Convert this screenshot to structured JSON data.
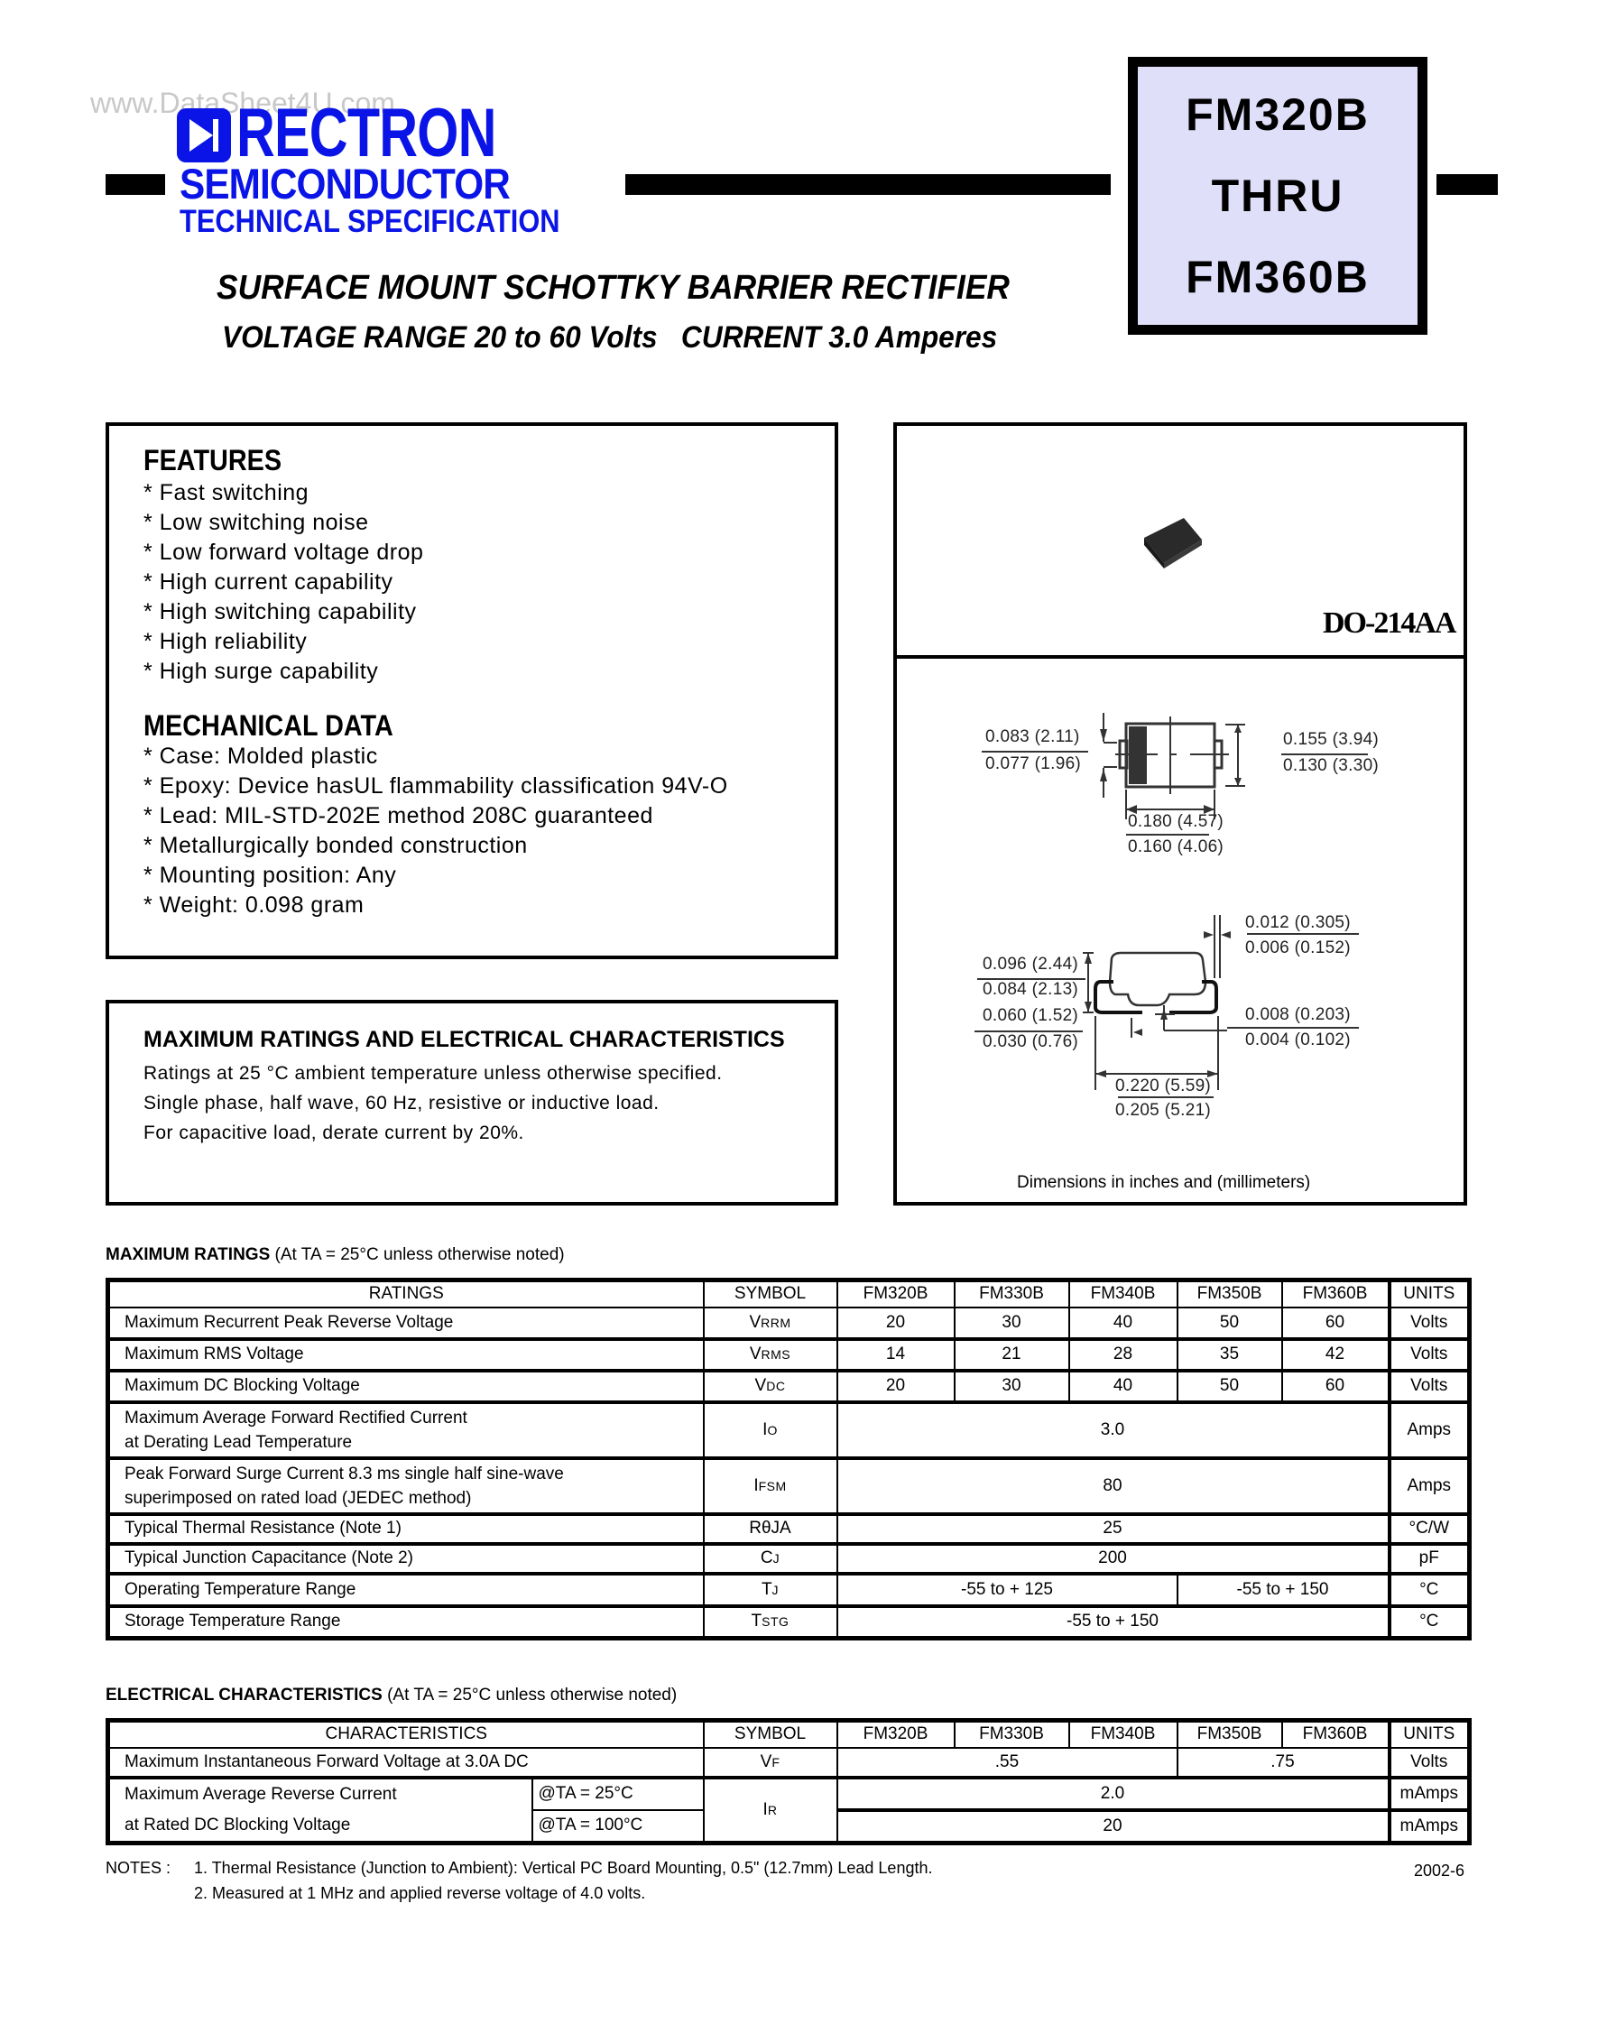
{
  "header": {
    "watermark": "www.DataSheet4U.com",
    "brand": "RECTRON",
    "division": "SEMICONDUCTOR",
    "doc_type": "TECHNICAL SPECIFICATION",
    "brand_color": "#0a14e6",
    "part_range": [
      "FM320B",
      "THRU",
      "FM360B"
    ],
    "part_box_color": "#dfdff9"
  },
  "title": {
    "line1": "SURFACE MOUNT SCHOTTKY BARRIER RECTIFIER",
    "line2": "VOLTAGE RANGE 20 to 60 Volts   CURRENT 3.0 Amperes"
  },
  "features": {
    "heading": "FEATURES",
    "items": [
      "* Fast switching",
      "* Low switching noise",
      "* Low forward voltage drop",
      "* High current capability",
      "* High switching capability",
      "* High reliability",
      "* High surge capability"
    ]
  },
  "mechanical": {
    "heading": "MECHANICAL DATA",
    "items": [
      "* Case: Molded plastic",
      "* Epoxy: Device hasUL flammability classification 94V-O",
      "* Lead: MIL-STD-202E method 208C guaranteed",
      "* Metallurgically bonded construction",
      "* Mounting position: Any",
      "* Weight: 0.098 gram"
    ]
  },
  "ratings_note": {
    "heading": "MAXIMUM RATINGS AND ELECTRICAL CHARACTERISTICS",
    "lines": [
      "Ratings at 25 °C ambient temperature unless otherwise specified.",
      "Single phase, half wave, 60 Hz, resistive or inductive load.",
      "For capacitive load, derate current by 20%."
    ]
  },
  "package": {
    "name": "DO-214AA",
    "top_view": {
      "height_lead": [
        "0.083 (2.11)",
        "0.077 (1.96)"
      ],
      "width_body": [
        "0.155 (3.94)",
        "0.130 (3.30)"
      ],
      "length_body": [
        "0.180 (4.57)",
        "0.160 (4.06)"
      ]
    },
    "side_view": {
      "lead_thickness": [
        "0.012 (0.305)",
        "0.006 (0.152)"
      ],
      "height": [
        "0.096 (2.44)",
        "0.084 (2.13)"
      ],
      "lead_length": [
        "0.060 (1.52)",
        "0.030 (0.76)"
      ],
      "standoff": [
        "0.008 (0.203)",
        "0.004 (0.102)"
      ],
      "overall_length": [
        "0.220 (5.59)",
        "0.205 (5.21)"
      ]
    },
    "caption": "Dimensions in inches and (millimeters)"
  },
  "max_ratings": {
    "heading_bold": "MAXIMUM RATINGS",
    "heading_rest": " (At TA = 25°C unless otherwise noted)",
    "columns": [
      "RATINGS",
      "SYMBOL",
      "FM320B",
      "FM330B",
      "FM340B",
      "FM350B",
      "FM360B",
      "UNITS"
    ],
    "rows": [
      {
        "param": "Maximum Recurrent Peak Reverse Voltage",
        "sym": "V",
        "sub": "RRM",
        "values": [
          "20",
          "30",
          "40",
          "50",
          "60"
        ],
        "unit": "Volts"
      },
      {
        "param": "Maximum RMS Voltage",
        "sym": "V",
        "sub": "RMS",
        "values": [
          "14",
          "21",
          "28",
          "35",
          "42"
        ],
        "unit": "Volts"
      },
      {
        "param": "Maximum DC Blocking Voltage",
        "sym": "V",
        "sub": "DC",
        "values": [
          "20",
          "30",
          "40",
          "50",
          "60"
        ],
        "unit": "Volts"
      },
      {
        "param": "Maximum Average Forward Rectified Current\nat Derating Lead Temperature",
        "sym": "I",
        "sub": "O",
        "value_all": "3.0",
        "unit": "Amps"
      },
      {
        "param": "Peak Forward Surge Current 8.3 ms single half sine-wave\nsuperimposed on rated load (JEDEC method)",
        "sym": "I",
        "sub": "FSM",
        "value_all": "80",
        "unit": "Amps"
      },
      {
        "param": "Typical Thermal Resistance (Note 1)",
        "sym": "RθJA",
        "sub": "",
        "value_all": "25",
        "unit": "°C/W"
      },
      {
        "param": "Typical Junction Capacitance (Note 2)",
        "sym": "C",
        "sub": "J",
        "value_all": "200",
        "unit": "pF"
      },
      {
        "param": "Operating Temperature Range",
        "sym": "T",
        "sub": "J",
        "value_a": "-55 to + 125",
        "value_b": "-55 to + 150",
        "unit": "°C"
      },
      {
        "param": "Storage Temperature Range",
        "sym": "T",
        "sub": "STG",
        "value_all": "-55 to + 150",
        "unit": "°C"
      }
    ]
  },
  "elec_chars": {
    "heading_bold": "ELECTRICAL CHARACTERISTICS",
    "heading_rest": " (At TA = 25°C unless otherwise noted)",
    "columns": [
      "CHARACTERISTICS",
      "SYMBOL",
      "FM320B",
      "FM330B",
      "FM340B",
      "FM350B",
      "FM360B",
      "UNITS"
    ],
    "vf": {
      "param": "Maximum Instantaneous Forward Voltage at 3.0A DC",
      "sym": "V",
      "sub": "F",
      "value_a": ".55",
      "value_b": ".75",
      "unit": "Volts"
    },
    "ir": {
      "param_line1": "Maximum Average Reverse Current",
      "param_line2": "at Rated DC Blocking Voltage",
      "cond1": "@TA = 25°C",
      "cond2": "@TA = 100°C",
      "sym": "I",
      "sub": "R",
      "value1": "2.0",
      "value2": "20",
      "unit": "mAmps"
    }
  },
  "notes": {
    "label": "NOTES :",
    "items": [
      "1. Thermal Resistance (Junction to Ambient): Vertical PC Board Mounting, 0.5\" (12.7mm) Lead Length.",
      "2. Measured at 1 MHz and applied reverse voltage of 4.0 volts."
    ],
    "revision": "2002-6"
  }
}
